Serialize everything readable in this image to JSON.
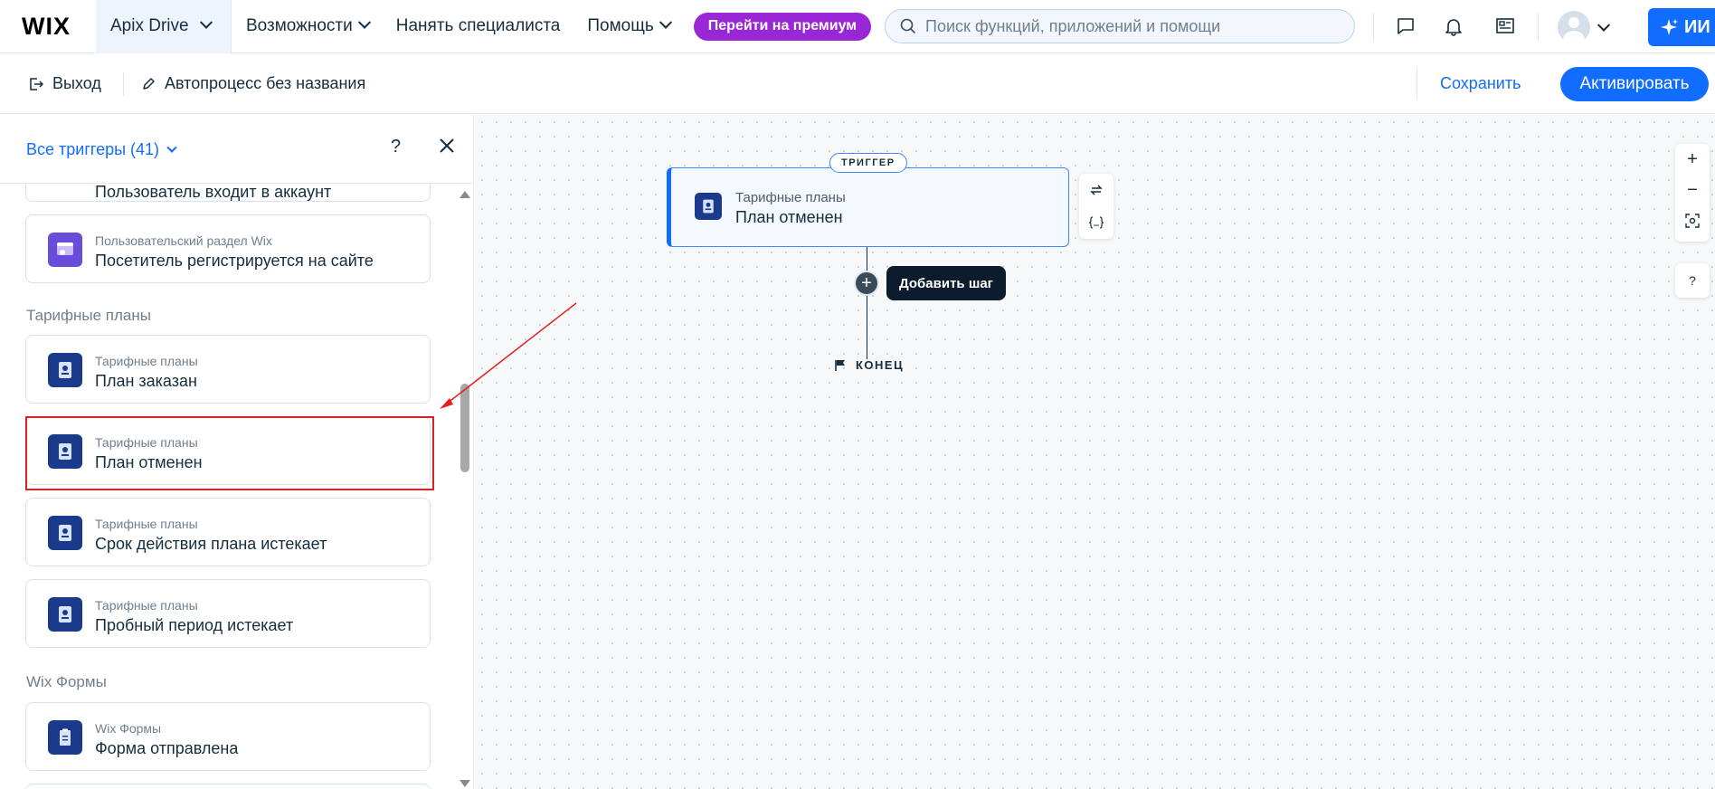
{
  "topnav": {
    "logo": "WIX",
    "site_name": "Apix Drive",
    "menu": [
      "Возможности",
      "Нанять специалиста",
      "Помощь"
    ],
    "premium_label": "Перейти на премиум",
    "search_placeholder": "Поиск функций, приложений и помощи",
    "ai_label": "ИИ",
    "accent_color": "#116dff",
    "premium_color": "#9a27d5"
  },
  "subbar": {
    "exit_label": "Выход",
    "process_name": "Автопроцесс без названия",
    "save_label": "Сохранить",
    "activate_label": "Активировать"
  },
  "panel": {
    "filter_label": "Все триггеры (41)",
    "help_label": "?",
    "partial_item": "Пользователь входит в аккаунт",
    "items_top": [
      {
        "category": "Пользовательский раздел Wix",
        "title": "Посетитель регистрируется на сайте",
        "icon": "member-area-icon"
      }
    ],
    "section_plans": "Тарифные планы",
    "plans": [
      {
        "category": "Тарифные планы",
        "title": "План заказан",
        "icon": "plan-icon"
      },
      {
        "category": "Тарифные планы",
        "title": "План отменен",
        "icon": "plan-icon"
      },
      {
        "category": "Тарифные планы",
        "title": "Срок действия плана истекает",
        "icon": "plan-icon"
      },
      {
        "category": "Тарифные планы",
        "title": "Пробный период истекает",
        "icon": "plan-icon"
      }
    ],
    "section_forms": "Wix Формы",
    "forms": [
      {
        "category": "Wix Формы",
        "title": "Форма отправлена",
        "icon": "form-icon"
      }
    ],
    "highlight_color": "#e02020"
  },
  "canvas": {
    "trigger_pill": "ТРИГГЕР",
    "trigger_category": "Тарифные планы",
    "trigger_title": "План отменен",
    "add_step_label": "Добавить шаг",
    "end_label": "КОНЕЦ",
    "zoom_in": "+",
    "zoom_out": "−",
    "help_label": "?"
  }
}
